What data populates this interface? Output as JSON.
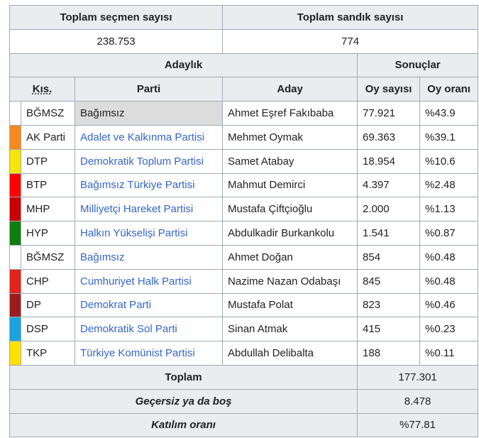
{
  "summary": {
    "voters_label": "Toplam seçmen sayısı",
    "boxes_label": "Toplam sandık sayısı",
    "voters_value": "238.753",
    "boxes_value": "774"
  },
  "groups": {
    "candidacy": "Adaylık",
    "results": "Sonuçlar"
  },
  "columns": {
    "abbr": "Kıs.",
    "party": "Parti",
    "candidate": "Aday",
    "votes": "Oy sayısı",
    "share": "Oy oranı"
  },
  "rows": [
    {
      "color": "#ffffff",
      "abbr": "BĞMSZ",
      "party": "Bağımsız",
      "candidate": "Ahmet Eşref Fakıbaba",
      "votes": "77.921",
      "share": "%43.9"
    },
    {
      "color": "#f58a1f",
      "abbr": "AK Parti",
      "party": "Adalet ve Kalkınma Partisi",
      "candidate": "Mehmet Oymak",
      "votes": "69.363",
      "share": "%39.1"
    },
    {
      "color": "#f5e50b",
      "abbr": "DTP",
      "party": "Demokratik Toplum Partisi",
      "candidate": "Samet Atabay",
      "votes": "18.954",
      "share": "%10.6"
    },
    {
      "color": "#ff0000",
      "abbr": "BTP",
      "party": "Bağımsız Türkiye Partisi",
      "candidate": "Mahmut Demirci",
      "votes": "4.397",
      "share": "%2.48"
    },
    {
      "color": "#c80000",
      "abbr": "MHP",
      "party": "Milliyetçi Hareket Partisi",
      "candidate": "Mustafa Çiftçioğlu",
      "votes": "2.000",
      "share": "%1.13"
    },
    {
      "color": "#0f7d0f",
      "abbr": "HYP",
      "party": "Halkın Yükselişi Partisi",
      "candidate": "Abdulkadir Burkankolu",
      "votes": "1.541",
      "share": "%0.87"
    },
    {
      "color": "#ffffff",
      "abbr": "BĞMSZ",
      "party": "Bağımsız",
      "candidate": "Ahmet Doğan",
      "votes": "854",
      "share": "%0.48"
    },
    {
      "color": "#e3221c",
      "abbr": "CHP",
      "party": "Cumhuriyet Halk Partisi",
      "candidate": "Nazime Nazan Odabaşı",
      "votes": "845",
      "share": "%0.48"
    },
    {
      "color": "#9b1c1c",
      "abbr": "DP",
      "party": "Demokrat Parti",
      "candidate": "Mustafa Polat",
      "votes": "823",
      "share": "%0.46"
    },
    {
      "color": "#1ba3e0",
      "abbr": "DSP",
      "party": "Demokratik Sol Parti",
      "candidate": "Sinan Atmak",
      "votes": "415",
      "share": "%0.23"
    },
    {
      "color": "#ffe200",
      "abbr": "TKP",
      "party": "Türkiye Komünist Partisi",
      "candidate": "Abdullah Delibalta",
      "votes": "188",
      "share": "%0.11"
    }
  ],
  "totals": [
    {
      "label": "Toplam",
      "value": "177.301",
      "italic": false
    },
    {
      "label": "Geçersiz ya da boş",
      "value": "8.478",
      "italic": true
    },
    {
      "label": "Katılım oranı",
      "value": "%77.81",
      "italic": true
    }
  ]
}
